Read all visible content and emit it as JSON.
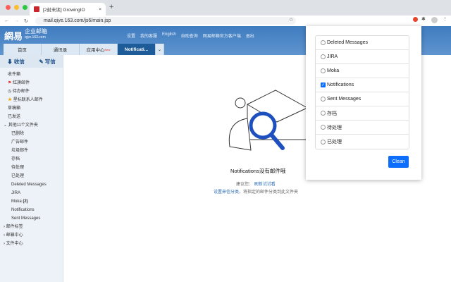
{
  "browser": {
    "tab_title": "[2封未读] GrowingIO",
    "url": "mail.qiye.163.com/js6/main.jsp",
    "new_tab": "+"
  },
  "header": {
    "logo": "網易",
    "brand": "企业邮箱",
    "brand_domain": "qiye.163.com",
    "links": [
      "设置",
      "我的客服",
      "English",
      "自助查询",
      "网易邮箱官方客户端",
      "退出"
    ]
  },
  "tabs": [
    {
      "label": "首页"
    },
    {
      "label": "通讯录"
    },
    {
      "label": "应用中心",
      "badge": "New"
    },
    {
      "label": "Notificati...",
      "active": true
    }
  ],
  "sidebar": {
    "receive": "收信",
    "compose": "写信",
    "items": [
      "收件箱",
      "红旗邮件",
      "待办邮件",
      "星标联系人邮件",
      "草稿箱",
      "已发送"
    ],
    "group": "其他11个文件夹",
    "folders": [
      "已删除",
      "广告邮件",
      "垃圾邮件",
      "存档",
      "待处理",
      "已处理",
      "Deleted Messages",
      "JIRA",
      "Moka",
      "Notifications",
      "Sent Messages"
    ],
    "moka_count": "(2)",
    "sections": [
      "邮件标签",
      "邮箱中心",
      "文件中心"
    ]
  },
  "content": {
    "empty_title": "Notifications没有邮件哦",
    "suggest_prefix": "建议您：",
    "refresh_link": "刷新试试看",
    "rule_link": "设置来信分类",
    "rule_suffix": "，将指定的邮件分类到此文件夹"
  },
  "popup": {
    "options": [
      {
        "label": "Deleted Messages",
        "checked": false
      },
      {
        "label": "JIRA",
        "checked": false
      },
      {
        "label": "Moka",
        "checked": false
      },
      {
        "label": "Notifications",
        "checked": true
      },
      {
        "label": "Sent Messages",
        "checked": false
      },
      {
        "label": "存档",
        "checked": false
      },
      {
        "label": "待处理",
        "checked": false
      },
      {
        "label": "已处理",
        "checked": false
      }
    ],
    "clean_label": "Clean"
  }
}
